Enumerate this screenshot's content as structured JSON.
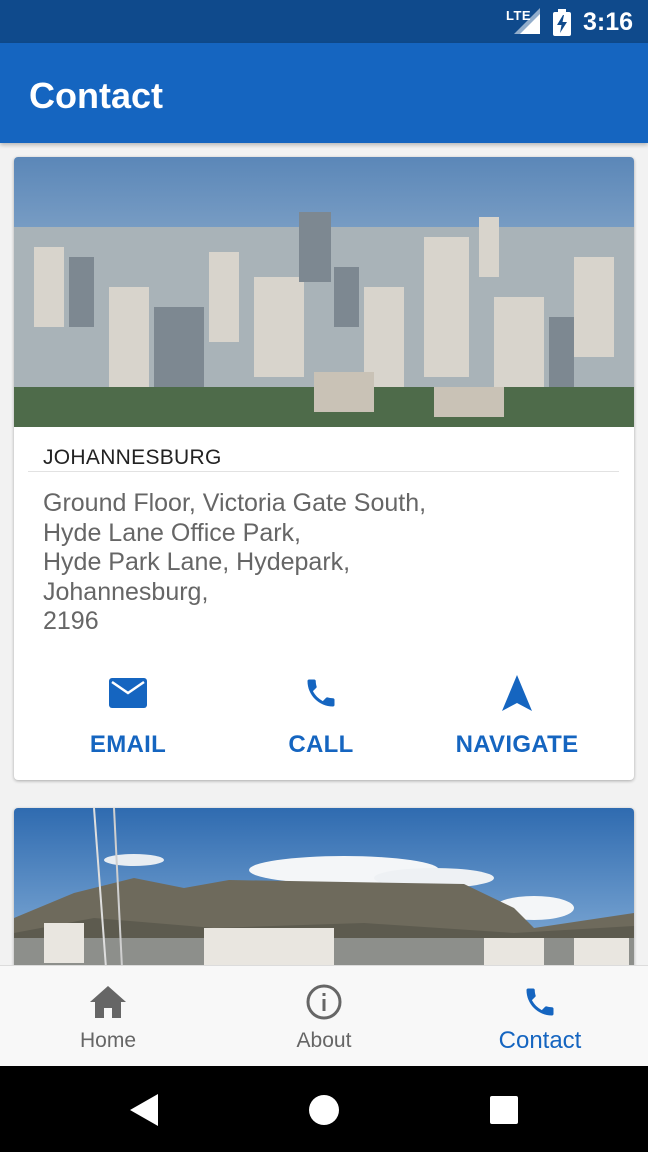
{
  "status_bar": {
    "network": "LTE",
    "time": "3:16"
  },
  "app_bar": {
    "title": "Contact"
  },
  "offices": [
    {
      "city": "JOHANNESBURG",
      "address_lines": [
        "Ground Floor, Victoria Gate South,",
        "Hyde Lane Office Park,",
        "Hyde Park Lane, Hydepark,",
        "Johannesburg,",
        "2196"
      ],
      "actions": {
        "email": "EMAIL",
        "call": "CALL",
        "navigate": "NAVIGATE"
      }
    }
  ],
  "bottom_nav": {
    "items": [
      {
        "label": "Home",
        "icon": "home-icon"
      },
      {
        "label": "About",
        "icon": "info-icon"
      },
      {
        "label": "Contact",
        "icon": "phone-icon"
      }
    ],
    "active": "Contact"
  },
  "colors": {
    "primary": "#1565c0",
    "status_bar": "#0f4a8c",
    "inactive": "#666666"
  }
}
